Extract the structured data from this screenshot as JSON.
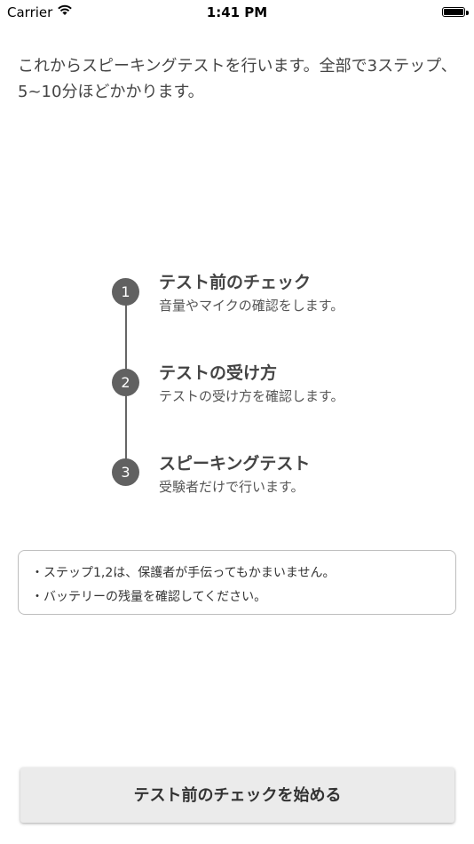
{
  "status_bar": {
    "carrier": "Carrier",
    "time": "1:41 PM",
    "wifi_icon": "wifi-icon",
    "battery_icon": "battery-icon",
    "battery_level": 1.0
  },
  "intro": {
    "text": "これからスピーキングテストを行います。全部で3ステップ、5~10分ほどかかります。"
  },
  "steps": [
    {
      "number": "1",
      "title": "テスト前のチェック",
      "description": "音量やマイクの確認をします。"
    },
    {
      "number": "2",
      "title": "テストの受け方",
      "description": "テストの受け方を確認します。"
    },
    {
      "number": "3",
      "title": "スピーキングテスト",
      "description": "受験者だけで行います。"
    }
  ],
  "notes": {
    "lines": [
      "・ステップ1,2は、保護者が手伝ってもかまいません。",
      "・バッテリーの残量を確認してください。"
    ]
  },
  "start_button": {
    "label": "テスト前のチェックを始める"
  }
}
